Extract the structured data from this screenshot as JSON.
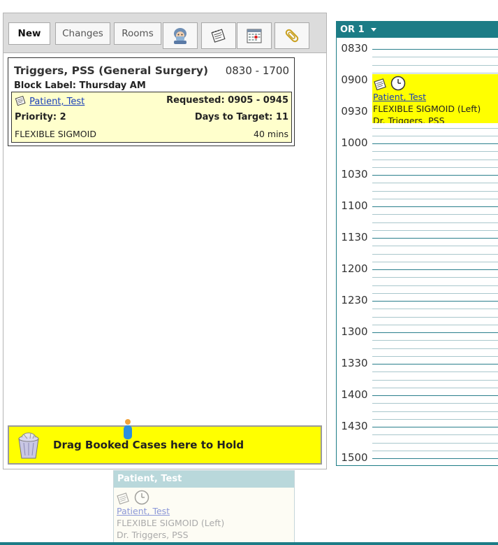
{
  "toolbar": {
    "buttons": [
      {
        "label": "New"
      },
      {
        "label": "Changes"
      },
      {
        "label": "Rooms"
      }
    ],
    "icons": [
      "surgeon-icon",
      "notepad-icon",
      "calendar-icon",
      "paperclip-icon"
    ]
  },
  "block": {
    "title": "Triggers, PSS (General Surgery)",
    "time": "0830 - 1700",
    "label_prefix": "Block Label:",
    "label_value": "Thursday AM",
    "case": {
      "patient": "Patient, Test",
      "requested": "Requested: 0905 - 0945",
      "priority": "Priority: 2",
      "days_to_target": "Days to Target: 11",
      "procedure": "FLEXIBLE SIGMOID",
      "duration": "40 mins"
    }
  },
  "hold_zone": {
    "text": "Drag Booked Cases here to Hold"
  },
  "drag_ghost": {
    "header": "Patient, Test",
    "patient": "Patient, Test",
    "procedure": "FLEXIBLE SIGMOID (Left)",
    "doctor": "Dr. Triggers, PSS"
  },
  "or_schedule": {
    "room": "OR 1",
    "times": [
      "0830",
      "0900",
      "0930",
      "1000",
      "1030",
      "1100",
      "1130",
      "1200",
      "1230",
      "1300",
      "1330",
      "1400",
      "1430",
      "1500"
    ],
    "appointment": {
      "patient": "Patient, Test",
      "procedure": "FLEXIBLE SIGMOID (Left)",
      "doctor": "Dr. Triggers, PSS",
      "color": "#ffff00"
    }
  },
  "colors": {
    "accent": "#1c7c86",
    "highlight": "#ffff00",
    "case_bg": "#ffffcc"
  }
}
